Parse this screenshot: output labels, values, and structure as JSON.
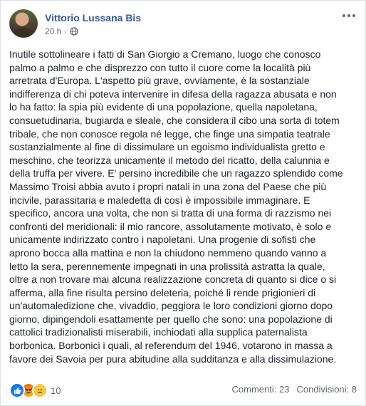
{
  "post": {
    "author": "Vittorio Lussana Bis",
    "time": "20 h",
    "separator": "·",
    "body": "Inutile sottolineare i fatti di San Giorgio a Cremano, luogo che conosco\npalmo a palmo e che disprezzo con tutto il cuore come la località più\narretrata d'Europa. L'aspetto più grave, ovviamente, è la sostanziale\nindifferenza di chi poteva intervenire in difesa della ragazza abusata e non\nlo ha fatto: la spia più evidente di una popolazione, quella napoletana,\nconsuetudinaria, bugiarda e sleale, che considera il cibo una sorta di totem\ntribale, che non conosce regola né legge, che finge una simpatia teatrale\nsostanzialmente al fine di dissimulare un egoismo individualista gretto e\nmeschino, che teorizza unicamente il metodo del ricatto, della calunnia e\ndella truffa per vivere. E' persino incredibile che un ragazzo splendido come\nMassimo Troisi abbia avuto i propri natali in una zona del Paese che più\nincivile, parassitaria e maledetta di così è impossibile immaginare. E\nspecifico, ancora una volta, che non si tratta di una forma di razzismo nei\nconfronti del meridionali: il mio rancore, assolutamente motivato, è solo e\nunicamente indirizzato contro i napoletani. Una progenie di sofisti che\naprono bocca alla mattina e non la chiudono nemmeno quando vanno a\nletto la sera, perennemente impegnati in una prolissità astratta la quale,\noltre a non trovare mai alcuna realizzazione concreta di quanto si dice o si\nafferma, alla fine risulta persino deleteria, poiché li rende prigionieri di\nun'automaledizione che, vivaddio, peggiora le loro condizioni giorno dopo\ngiorno, dipingendoli esattamente per quello che sono: una popolazione di\ncattolici tradizionalisti miserabili, inchiodati alla supplica paternalista\nborbonica. Borbonici i quali, al referendum del 1946, votarono in massa a\nfavore dei Savoia per pura abitudine alla sudditanza e alla dissimulazione."
  },
  "footer": {
    "reaction_count": "10",
    "comments": "Commenti: 23",
    "shares": "Condivisioni: 8"
  },
  "icons": {
    "privacy": "globe-icon",
    "more": "more-options-icon",
    "reactions": [
      "like-reaction-icon",
      "angry-reaction-icon",
      "sad-reaction-icon"
    ]
  },
  "colors": {
    "link": "#385898",
    "text": "#1d2129",
    "meta": "#616770",
    "like": "#1877f2"
  }
}
